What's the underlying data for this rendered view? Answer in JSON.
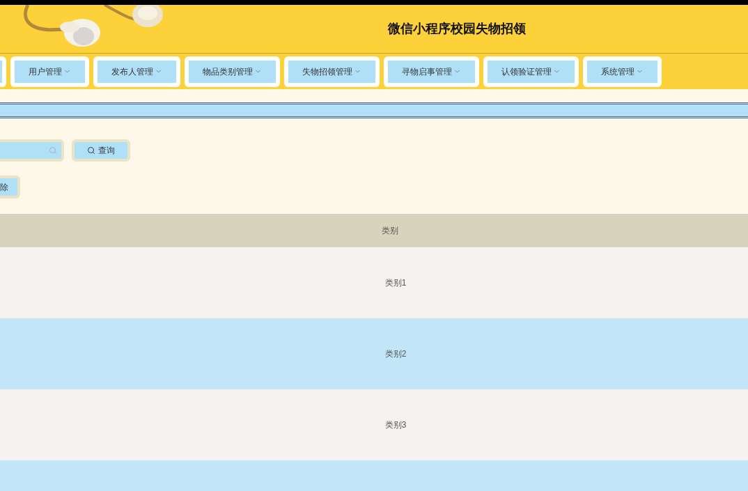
{
  "header": {
    "title": "微信小程序校园失物招领"
  },
  "nav": [
    {
      "kind": "clipped"
    },
    {
      "label": "用户管理"
    },
    {
      "label": "发布人管理"
    },
    {
      "label": "物品类别管理"
    },
    {
      "label": "失物招领管理"
    },
    {
      "label": "寻物启事管理"
    },
    {
      "label": "认领验证管理"
    },
    {
      "label": "系统管理"
    }
  ],
  "search": {
    "button": "查询"
  },
  "actions": [
    {
      "label": "除"
    }
  ],
  "table": {
    "columns": [
      "类别"
    ],
    "rows": [
      {
        "cells": [
          "类别1"
        ]
      },
      {
        "cells": [
          "类别2"
        ]
      },
      {
        "cells": [
          "类别3"
        ]
      }
    ]
  }
}
